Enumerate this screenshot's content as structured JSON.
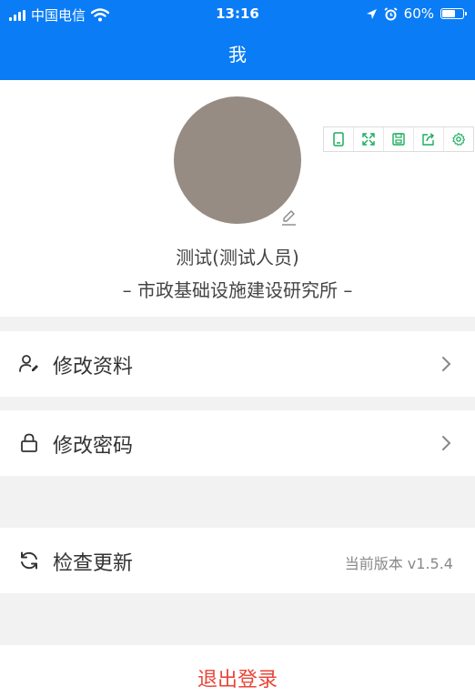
{
  "status_bar": {
    "carrier": "中国电信",
    "time": "13:16",
    "battery": "60%"
  },
  "nav": {
    "title": "我"
  },
  "profile": {
    "name": "测试(测试人员)",
    "organization": "– 市政基础设施建设研究所 –"
  },
  "menu": {
    "edit_profile": "修改资料",
    "change_password": "修改密码",
    "check_update": "检查更新",
    "current_version": "当前版本 v1.5.4"
  },
  "logout": {
    "label": "退出登录"
  },
  "colors": {
    "accent": "#0a7cf5",
    "danger": "#e8463a",
    "tool_green": "#1aad5c"
  }
}
